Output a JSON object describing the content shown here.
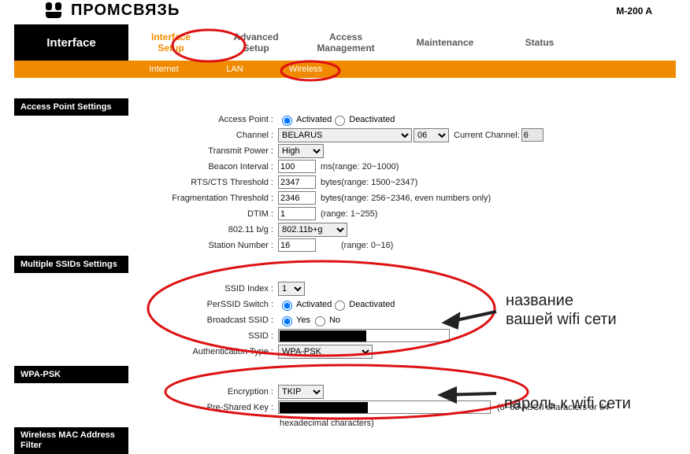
{
  "brand": "ПРОМСВЯЗЬ",
  "model": "M-200 A",
  "nav": {
    "left": "Interface",
    "items": [
      "Interface\nSetup",
      "Advanced\nSetup",
      "Access\nManagement",
      "Maintenance",
      "Status"
    ]
  },
  "subnav": {
    "items": [
      "Internet",
      "LAN",
      "Wireless"
    ]
  },
  "sections": {
    "ap": "Access Point Settings",
    "multi": "Multiple SSIDs Settings",
    "wpa": "WPA-PSK",
    "mac": "Wireless MAC Address Filter"
  },
  "labels": {
    "access_point": "Access Point :",
    "channel": "Channel :",
    "transmit": "Transmit Power :",
    "beacon": "Beacon Interval :",
    "rts": "RTS/CTS Threshold :",
    "frag": "Fragmentation Threshold :",
    "dtim": "DTIM :",
    "mode": "802.11 b/g :",
    "station": "Station Number :",
    "ssid_index": "SSID Index :",
    "perssid": "PerSSID Switch :",
    "broadcast": "Broadcast SSID :",
    "ssid": "SSID :",
    "auth": "Authentication Type :",
    "enc": "Encryption :",
    "psk": "Pre-Shared Key :"
  },
  "values": {
    "ap_activated": "Activated",
    "ap_deactivated": "Deactivated",
    "channel_country": "BELARUS",
    "channel_num": "06",
    "current_channel": "Current Channel:",
    "current_channel_val": "6",
    "transmit": "High",
    "beacon": "100",
    "beacon_hint": "ms(range: 20~1000)",
    "rts": "2347",
    "rts_hint": "bytes(range: 1500~2347)",
    "frag": "2346",
    "frag_hint": "bytes(range: 256~2346, even numbers only)",
    "dtim": "1",
    "dtim_hint": "(range: 1~255)",
    "mode": "802.11b+g",
    "station": "16",
    "station_hint": "(range: 0~16)",
    "ssid_index": "1",
    "perssid_act": "Activated",
    "perssid_deact": "Deactivated",
    "bc_yes": "Yes",
    "bc_no": "No",
    "ssid": "",
    "auth": "WPA-PSK",
    "enc": "TKIP",
    "psk": "",
    "psk_hint1": "(8~63 ASCII characters or 64",
    "psk_hint2": "hexadecimal characters)"
  },
  "annotations": {
    "ssid_label": "название\nвашей wifi сети",
    "psk_label": "пароль к wifi сети"
  }
}
